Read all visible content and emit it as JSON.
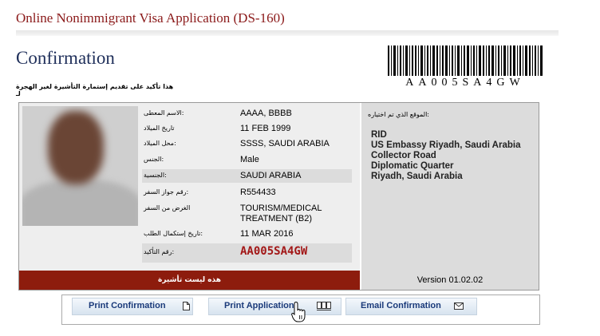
{
  "header": {
    "app_title": "Online Nonimmigrant Visa Application (DS-160)",
    "page_title": "Confirmation",
    "subtitle_ar": "هذا تأكيد على تقديم إستمارة التأشيرة لغير الهجرة لـ"
  },
  "barcode": {
    "code_text": "AA005SA4GW"
  },
  "applicant": {
    "fields": [
      {
        "label": ":الاسم المعطى",
        "value": "AAAA, BBBB"
      },
      {
        "label": "تاريخ الميلاد",
        "value": "11 FEB 1999"
      },
      {
        "label": ":محل الميلاد",
        "value": "SSSS, SAUDI ARABIA"
      },
      {
        "label": ":الجنس",
        "value": "Male"
      },
      {
        "label": ":الجنسية",
        "value": "SAUDI ARABIA"
      },
      {
        "label": ":رقم جواز السفر",
        "value": "R554433"
      },
      {
        "label": "الغرض من السفر",
        "value": "TOURISM/MEDICAL TREATMENT (B2)"
      },
      {
        "label": ":تاريخ إستكمال الطلب",
        "value": "11 MAR 2016"
      },
      {
        "label": ":رقم التأكيد",
        "value": "AA005SA4GW"
      }
    ],
    "banner_text": "هذه ليست تأشيرة"
  },
  "location": {
    "label": ":الموقع الذي تم اختياره",
    "lines": [
      "RID",
      "US Embassy Riyadh, Saudi Arabia",
      "Collector Road",
      "Diplomatic Quarter",
      "Riyadh, Saudi Arabia"
    ]
  },
  "version_text": "Version 01.02.02",
  "buttons": {
    "print_confirmation": "Print Confirmation",
    "print_application": "Print Application",
    "email_confirmation": "Email Confirmation"
  },
  "icons": {
    "print_confirmation": "page-icon",
    "print_application": "pages-icon",
    "email_confirmation": "envelope-icon",
    "cursor": "hand-cursor-icon"
  },
  "colors": {
    "title_red": "#8b1a1a",
    "heading_blue": "#1f2f5a",
    "banner_red": "#8d1c0d",
    "confirmation_red": "#a31818",
    "button_text": "#1a3a7a"
  }
}
